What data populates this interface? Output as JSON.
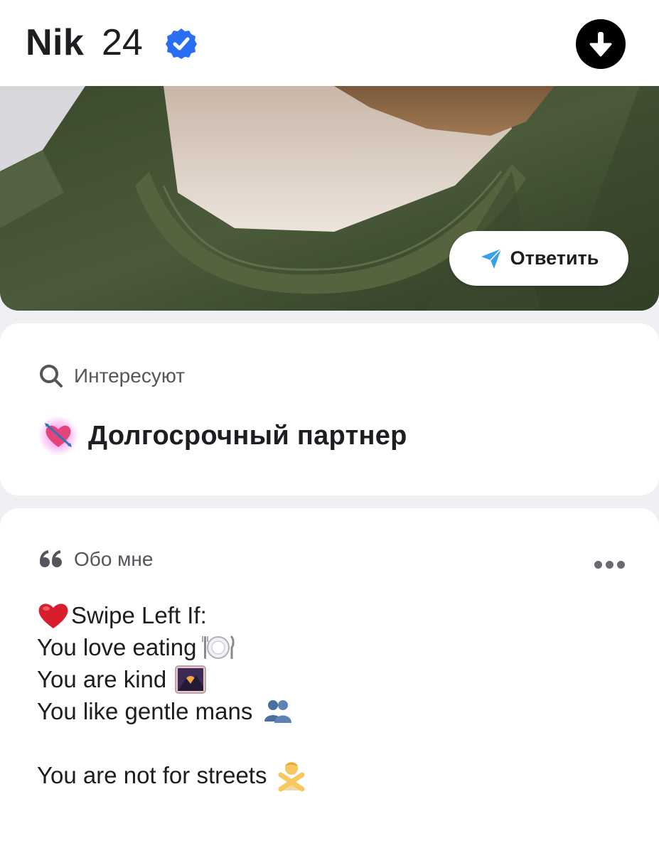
{
  "header": {
    "name": "Nik",
    "age": "24",
    "verified_icon": "verified-badge-icon",
    "download_icon": "download-arrow-icon"
  },
  "photo": {
    "reply_button_label": "Ответить",
    "reply_icon": "paper-plane-icon"
  },
  "interests": {
    "title": "Интересуют",
    "icon": "search-icon",
    "value": "Долгосрочный партнер",
    "value_icon": "heart-with-arrow-icon"
  },
  "about": {
    "title": "Обо мне",
    "icon": "quote-icon",
    "menu_icon": "more-dots-icon",
    "lines": [
      "Swipe Left If:",
      "You love eating",
      "You are kind",
      "You like gentle mans",
      "",
      "You are not for streets"
    ]
  },
  "colors": {
    "verified_blue": "#2a6ef3",
    "text_primary": "#1d1d22",
    "text_secondary": "#55555c",
    "background": "#f0f0f4"
  }
}
